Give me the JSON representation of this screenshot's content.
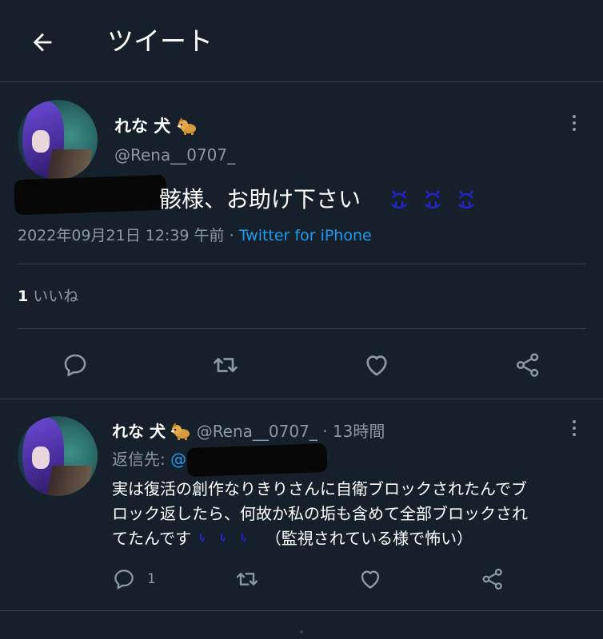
{
  "header": {
    "title": "ツイート"
  },
  "main_tweet": {
    "display_name": "れな 犬",
    "handle": "@Rena__0707_",
    "text": "骸様、お助け下さい",
    "timestamp": "2022年09月21日 12:39 午前",
    "separator": "·",
    "client": "Twitter for iPhone",
    "likes_count": "1",
    "likes_label": "いいね"
  },
  "reply": {
    "display_name": "れな 犬",
    "handle": "@Rena__0707_",
    "separator": "·",
    "time": "13時間",
    "reply_to_label": "返信先:",
    "reply_to_handle": "@",
    "text_line1": "実は復活の創作なりきりさんに自衛ブロックされたんでブ",
    "text_line2": "ロック返したら、何故か私の垢も含めて全部ブロックされ",
    "text_line3_a": "てたんです",
    "text_line3_b": "（監視されている様で怖い）",
    "reply_count": "1"
  },
  "colors": {
    "background": "#15202b",
    "divider": "#38444d",
    "muted": "#8b98a5",
    "link": "#1d9bf0",
    "emoji_blue": "#2424c8"
  },
  "icons": {
    "back": "arrow-left-icon",
    "more": "more-vertical-icon",
    "reply": "reply-icon",
    "retweet": "retweet-icon",
    "like": "heart-icon",
    "share": "share-icon",
    "dog": "dog-emoji-icon",
    "crying": "crying-face-emoji-icon",
    "tear": "tear-emoji-icon"
  }
}
